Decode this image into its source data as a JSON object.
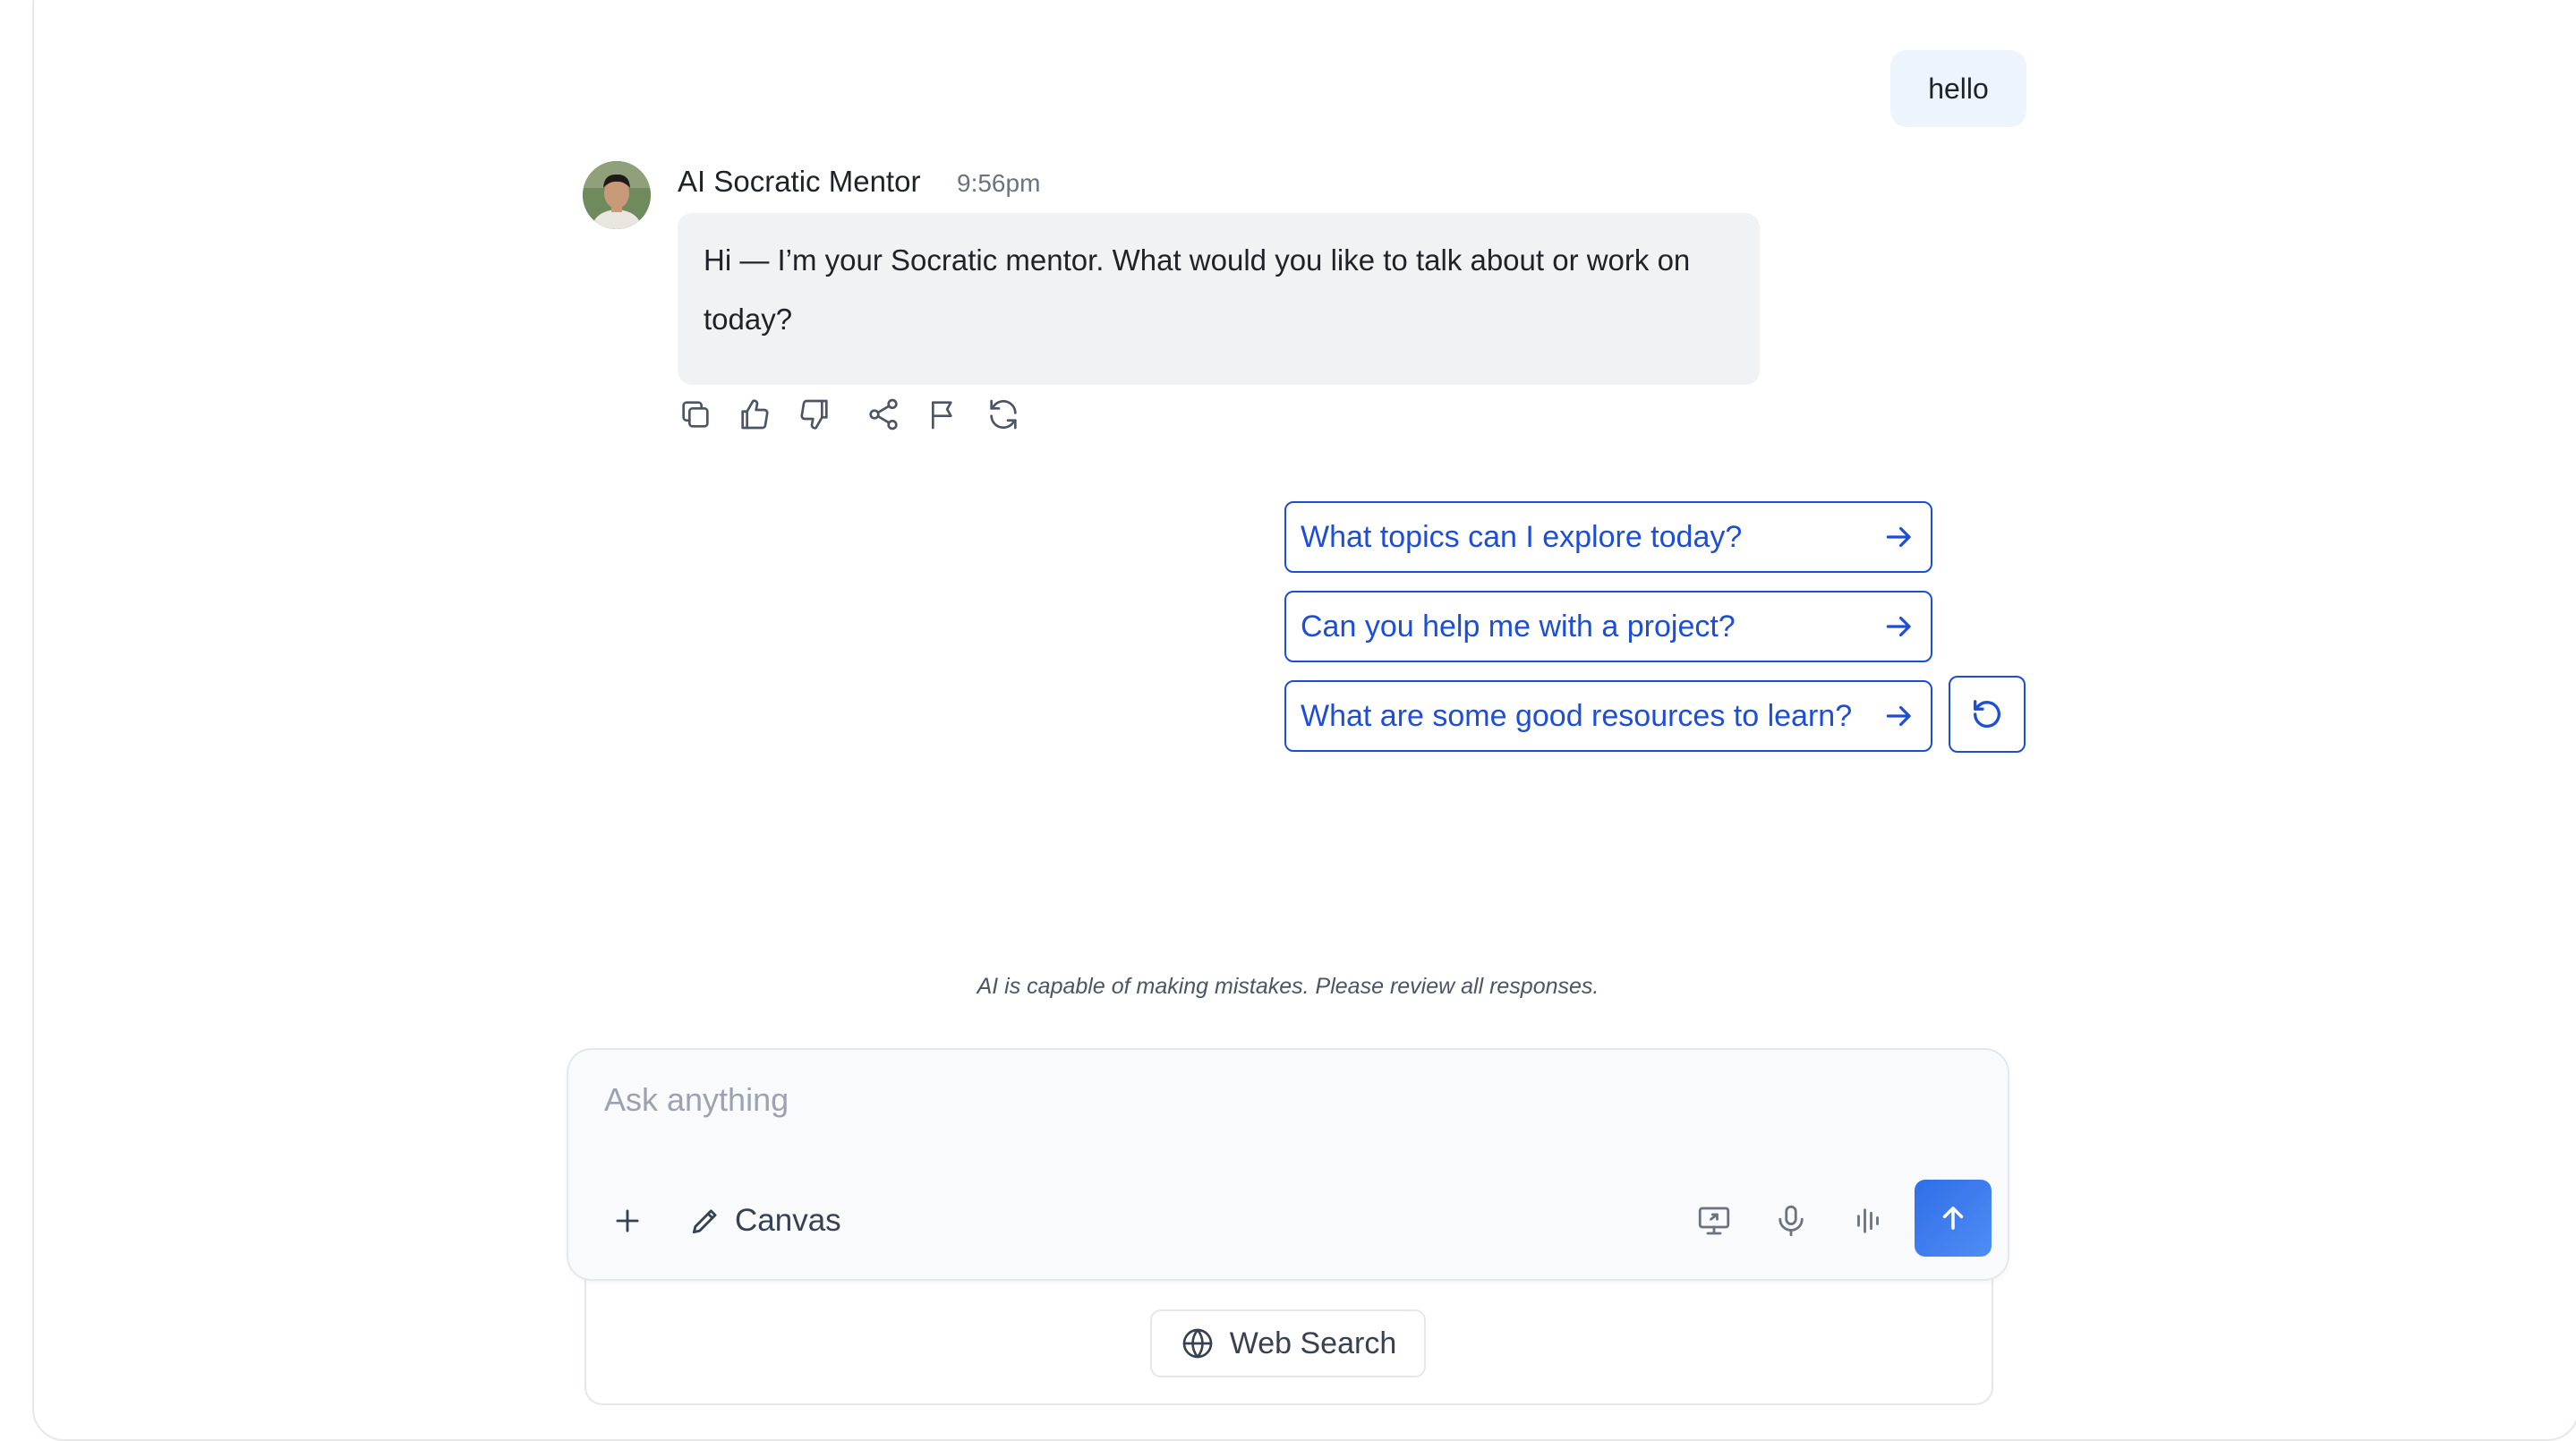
{
  "conversation": {
    "user_message": "hello",
    "assistant": {
      "name": "AI Socratic Mentor",
      "time": "9:56pm",
      "message": "Hi — I’m your Socratic mentor. What would you like to talk about or work on today?"
    }
  },
  "message_actions": [
    "copy-icon",
    "thumbs-up-icon",
    "thumbs-down-icon",
    "share-icon",
    "flag-icon",
    "regenerate-icon"
  ],
  "suggestions": [
    "What topics can I explore today?",
    "Can you help me with a project?",
    "What are some good resources to learn?"
  ],
  "disclaimer": "AI is capable of making mistakes. Please review all responses.",
  "composer": {
    "placeholder": "Ask anything",
    "canvas_label": "Canvas",
    "tools": [
      "screen-share-icon",
      "microphone-icon",
      "voice-waveform-icon"
    ],
    "send_icon": "arrow-up-icon"
  },
  "web_search_label": "Web Search",
  "colors": {
    "accent": "#1d4ed8",
    "send_button": "#3b7cf0",
    "assistant_bubble": "#f1f2f4",
    "user_bubble": "#eef4fc"
  }
}
